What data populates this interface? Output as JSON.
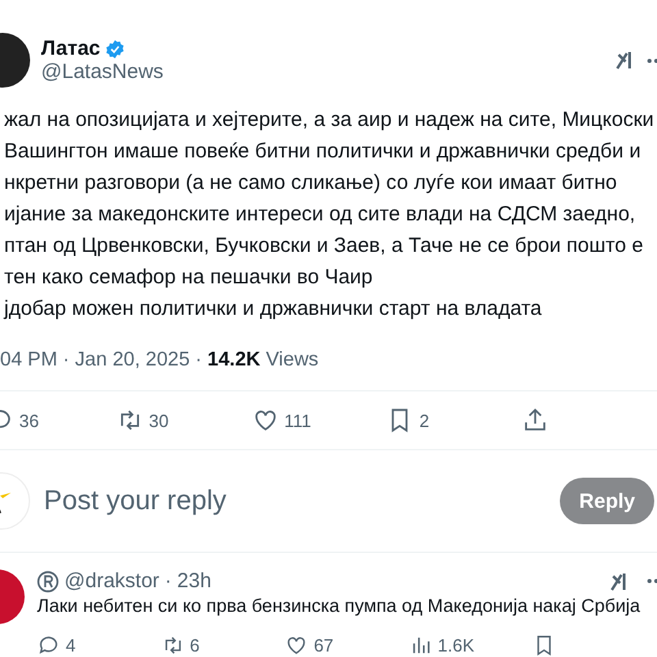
{
  "post": {
    "author": {
      "name": "Латас",
      "verified": true,
      "handle": "@LatasNews"
    },
    "text_lines": [
      "жал на опозицијата и хејтерите, а за аир и надеж на сите, Мицкоски",
      "Вашингтон имаше повеќе битни политички и државнички средби и",
      "нкретни разговори (а не само сликање) со луѓе кои имаат битно",
      "ијание за македонските интереси од сите влади на СДСМ заедно,",
      "птан од Црвенковски, Бучковски и Заев, а Таче не се брои пошто е",
      "тен како семафор на пешачки во Чаир",
      "јдобар можен политички и државнички старт на владата"
    ],
    "meta": "04 PM · Jan 20, 2025 · **14.2K** Views",
    "actions": [
      {
        "kind": "reply",
        "count": "36"
      },
      {
        "kind": "repost",
        "count": "30"
      },
      {
        "kind": "like",
        "count": "111"
      },
      {
        "kind": "bookmark",
        "count": "2"
      },
      {
        "kind": "share"
      }
    ]
  },
  "composer": {
    "placeholder": "Post your reply",
    "button": "Reply",
    "disabled": true
  },
  "replies": [
    {
      "handle": "@drakstor",
      "separator": "·",
      "time": "23h",
      "text": "Лаки небитен си ко прва бензинска пумпа од Македонија накај Србија",
      "actions": [
        {
          "kind": "reply",
          "count": "4"
        },
        {
          "kind": "repost",
          "count": "6"
        },
        {
          "kind": "like",
          "count": "67"
        },
        {
          "kind": "views",
          "count": "1.6K"
        },
        {
          "kind": "bookmark"
        }
      ]
    }
  ]
}
